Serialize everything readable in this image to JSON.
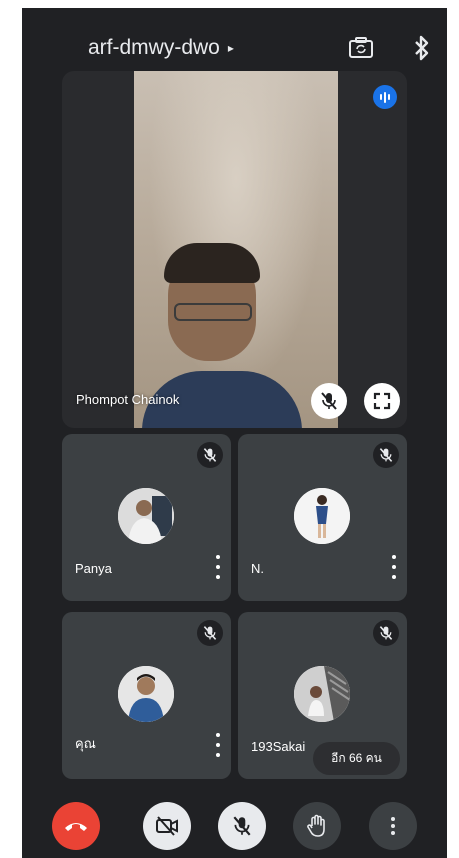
{
  "header": {
    "meeting_code": "arf-dmwy-dwo",
    "meeting_code_caret": "▸"
  },
  "main": {
    "name": "Phompot Chainok"
  },
  "tiles": [
    {
      "name": "Panya",
      "avatar": "avatar-photo"
    },
    {
      "name": "N.",
      "avatar": "avatar-photo"
    },
    {
      "name": "คุณ",
      "avatar": "avatar-photo"
    },
    {
      "name": "193Sakai",
      "avatar": "avatar-photo"
    }
  ],
  "others_chip": {
    "label": "อีก 66 คน"
  },
  "colors": {
    "background": "#202124",
    "tile": "#3c4043",
    "end_call": "#ea4335",
    "speaking": "#1a73e8",
    "control_light": "#e8eaed",
    "control_dark": "#3c4043"
  },
  "icons": {
    "camera_switch": "camera-switch-icon",
    "bluetooth": "bluetooth-icon",
    "mic_off": "mic-off-icon",
    "fullscreen": "fullscreen-icon",
    "end_call": "end-call-icon",
    "video_off": "video-off-icon",
    "raise_hand": "raise-hand-icon",
    "more": "more-vertical-icon"
  }
}
